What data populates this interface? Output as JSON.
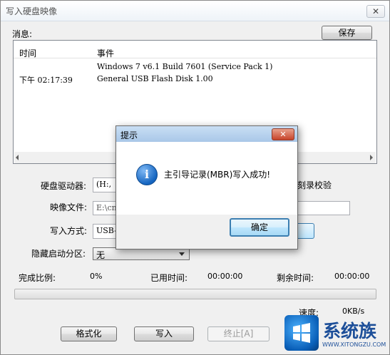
{
  "window": {
    "title": "写入硬盘映像",
    "close_glyph": "✕"
  },
  "messages": {
    "label": "消息:",
    "save_button": "保存",
    "columns": [
      "时间",
      "事件"
    ],
    "rows": [
      {
        "time": "",
        "event": "Windows 7 v6.1 Build 7601 (Service Pack 1)"
      },
      {
        "time": "下午 02:17:39",
        "event": "General USB Flash Disk  1.00"
      }
    ]
  },
  "form": {
    "drive_label": "硬盘驱动器:",
    "drive_value": "(H:,",
    "verify_label": "刻录校验",
    "image_label": "映像文件:",
    "image_value": "E:\\cn",
    "method_label": "写入方式:",
    "method_value": "USB-Z",
    "hidden_label": "隐藏启动分区:",
    "hidden_value": "无"
  },
  "status": {
    "ratio_label": "完成比例:",
    "ratio_value": "0%",
    "elapsed_label": "已用时间:",
    "elapsed_value": "00:00:00",
    "remaining_label": "剩余时间:",
    "remaining_value": "00:00:00",
    "progress": 0,
    "speed_label": "速度:",
    "speed_value": "0KB/s"
  },
  "buttons": {
    "format": "格式化",
    "write": "写入",
    "abort": "终止[A]"
  },
  "dialog": {
    "title": "提示",
    "close_glyph": "✕",
    "info_glyph": "i",
    "message": "主引导记录(MBR)写入成功!",
    "ok": "确定"
  },
  "watermark": {
    "brand": "系统族",
    "url": "WWW.XITONGZU.COM"
  },
  "colors": {
    "dialog_title": "#a9c7e8",
    "info_icon": "#1565c0",
    "ok_focus": "#3c7fb1"
  }
}
